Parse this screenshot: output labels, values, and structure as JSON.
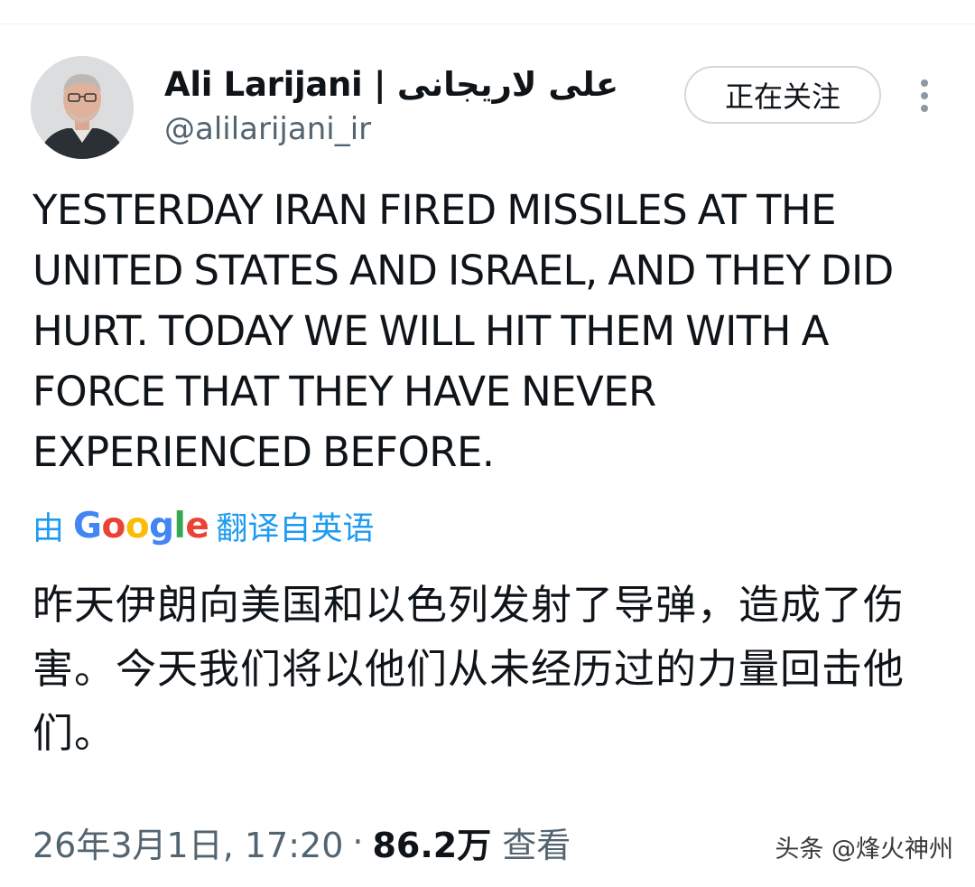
{
  "user": {
    "display_name": "Ali Larijani | علی لاریجانی",
    "handle": "@alilarijani_ir"
  },
  "follow_button": {
    "label": "正在关注"
  },
  "more_icon": "more-vertical-icon",
  "tweet": {
    "text": "YESTERDAY IRAN FIRED MISSILES AT THE UNITED STATES AND ISRAEL, AND THEY DID HURT. TODAY WE WILL HIT THEM WITH A FORCE THAT THEY HAVE NEVER EXPERIENCED BEFORE."
  },
  "translation": {
    "prefix": "由",
    "logo_text": "Google",
    "suffix": "翻译自英语",
    "text": "昨天伊朗向美国和以色列发射了导弹，造成了伤害。今天我们将以他们从未经历过的力量回击他们。"
  },
  "meta": {
    "timestamp": "26年3月1日, 17:20",
    "separator": "·",
    "views_count": "86.2万",
    "views_label": "查看"
  },
  "watermark": "头条 @烽火神州",
  "colors": {
    "link_blue": "#1d9bf0",
    "secondary_text": "#536471",
    "primary_text": "#0f1419",
    "border": "#cfd9de",
    "google_blue": "#4285f4",
    "google_red": "#ea4335",
    "google_yellow": "#fbbc05",
    "google_green": "#34a853"
  }
}
